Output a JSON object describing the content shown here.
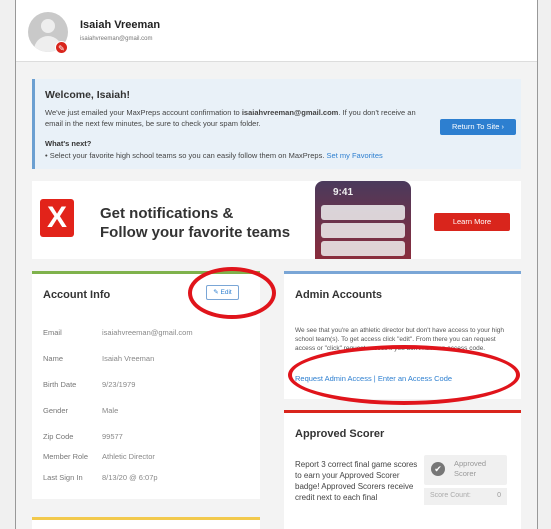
{
  "header": {
    "name": "Isaiah Vreeman",
    "email": "isaiahvreeman@gmail.com"
  },
  "welcome": {
    "title": "Welcome, Isaiah!",
    "text_prefix": "We've just emailed your MaxPreps account confirmation to ",
    "email": "isaiahvreeman@gmail.com",
    "text_suffix": ". If you don't receive an email in the next few minutes, be sure to check your spam folder.",
    "return_button": "Return To Site ›",
    "next_title": "What's next?",
    "next_item": "Select your favorite high school teams so you can easily follow them on MaxPreps.",
    "next_link": "Set my Favorites"
  },
  "banner": {
    "logo_letter": "X",
    "line1": "Get notifications &",
    "line2": "Follow your favorite teams",
    "phone_time": "9:41",
    "learn_more": "Learn More"
  },
  "account": {
    "title": "Account Info",
    "edit_label": "✎ Edit",
    "fields": [
      {
        "label": "Email",
        "value": "isaiahvreeman@gmail.com"
      },
      {
        "label": "Name",
        "value": "Isaiah Vreeman"
      },
      {
        "label": "Birth Date",
        "value": "9/23/1979"
      },
      {
        "label": "Gender",
        "value": "Male"
      },
      {
        "label": "Zip Code",
        "value": "99577"
      },
      {
        "label": "Member Role",
        "value": "Athletic Director"
      },
      {
        "label": "Last Sign In",
        "value": "8/13/20 @ 6:07p"
      }
    ]
  },
  "admin": {
    "title": "Admin Accounts",
    "text": "We see that you're an athletic director but don't have access to your high school team(s). To get access click \"edit\". From there you can request access or \"click\" request access if you don't have an access code.",
    "link1": "Request Admin Access",
    "separator": " | ",
    "link2": "Enter an Access Code"
  },
  "scorer": {
    "title": "Approved Scorer",
    "text": "Report 3 correct final game scores to earn your Approved Scorer badge! Approved Scorers receive credit next to each final",
    "status_line1": "Approved",
    "status_line2": "Scorer",
    "count_label": "Score Count:",
    "count_value": "0"
  },
  "colors": {
    "brand_red": "#d9251c",
    "link_blue": "#2d7fd0",
    "annotation_red": "#e0141b"
  }
}
